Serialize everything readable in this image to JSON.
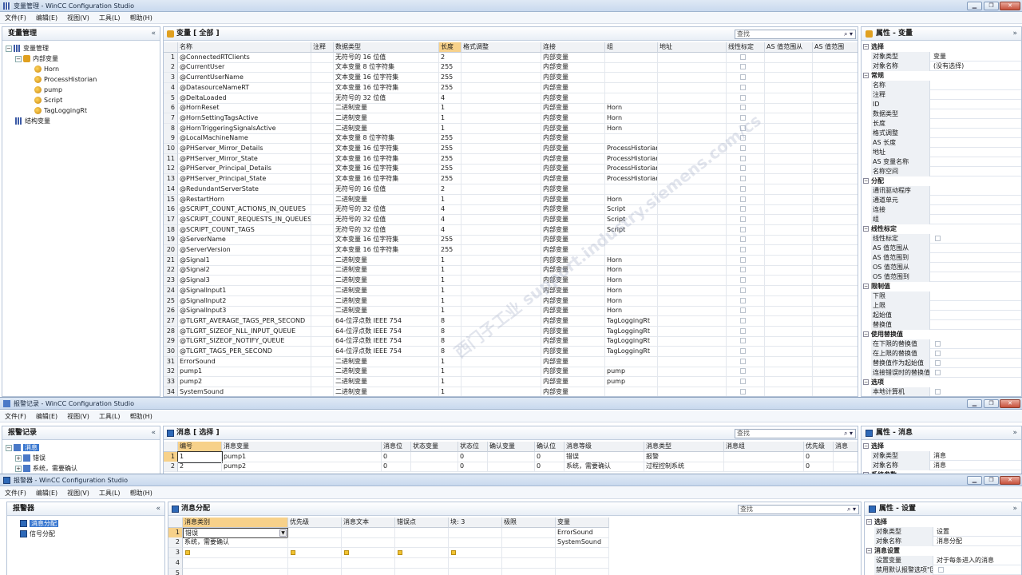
{
  "window1": {
    "title": "变量管理 - WinCC Configuration Studio",
    "menu": [
      "文件(F)",
      "编辑(E)",
      "视图(V)",
      "工具(L)",
      "帮助(H)"
    ],
    "nav_title": "变量管理",
    "tree": [
      {
        "label": "变量管理",
        "level": 0,
        "toggle": "−",
        "icon": "ic-bars",
        "name": "tree-tag-management"
      },
      {
        "label": "内部变量",
        "level": 1,
        "toggle": "−",
        "icon": "ic-db",
        "name": "tree-internal-tags"
      },
      {
        "label": "Horn",
        "level": 2,
        "icon": "ic-tag",
        "name": "tree-group-horn"
      },
      {
        "label": "ProcessHistorian",
        "level": 2,
        "icon": "ic-tag",
        "name": "tree-group-processhistorian"
      },
      {
        "label": "pump",
        "level": 2,
        "icon": "ic-tag",
        "name": "tree-group-pump"
      },
      {
        "label": "Script",
        "level": 2,
        "icon": "ic-tag",
        "name": "tree-group-script"
      },
      {
        "label": "TagLoggingRt",
        "level": 2,
        "icon": "ic-tag",
        "name": "tree-group-tagloggingrt"
      },
      {
        "label": "结构变量",
        "level": 0,
        "icon": "ic-bars",
        "name": "tree-struct-tags"
      }
    ],
    "grid_title": "变量 [ 全部 ]",
    "search_placeholder": "查找",
    "columns": [
      "",
      "名称",
      "注释",
      "数据类型",
      "长度",
      "格式调整",
      "连接",
      "组",
      "地址",
      "线性标定",
      "AS 值范围从",
      "AS 值范围"
    ],
    "rows": [
      [
        "1",
        "@ConnectedRTClients",
        "",
        "无符号的 16 位值",
        "2",
        "",
        "内部变量",
        "",
        ""
      ],
      [
        "2",
        "@CurrentUser",
        "",
        "文本变量 8 位字符集",
        "255",
        "",
        "内部变量",
        "",
        ""
      ],
      [
        "3",
        "@CurrentUserName",
        "",
        "文本变量 16 位字符集",
        "255",
        "",
        "内部变量",
        "",
        ""
      ],
      [
        "4",
        "@DatasourceNameRT",
        "",
        "文本变量 16 位字符集",
        "255",
        "",
        "内部变量",
        "",
        ""
      ],
      [
        "5",
        "@DeltaLoaded",
        "",
        "无符号的 32 位值",
        "4",
        "",
        "内部变量",
        "",
        ""
      ],
      [
        "6",
        "@HornReset",
        "",
        "二进制变量",
        "1",
        "",
        "内部变量",
        "Horn",
        ""
      ],
      [
        "7",
        "@HornSettingTagsActive",
        "",
        "二进制变量",
        "1",
        "",
        "内部变量",
        "Horn",
        ""
      ],
      [
        "8",
        "@HornTriggeringSignalsActive",
        "",
        "二进制变量",
        "1",
        "",
        "内部变量",
        "Horn",
        ""
      ],
      [
        "9",
        "@LocalMachineName",
        "",
        "文本变量 8 位字符集",
        "255",
        "",
        "内部变量",
        "",
        ""
      ],
      [
        "10",
        "@PHServer_Mirror_Details",
        "",
        "文本变量 16 位字符集",
        "255",
        "",
        "内部变量",
        "ProcessHistorian",
        ""
      ],
      [
        "11",
        "@PHServer_Mirror_State",
        "",
        "文本变量 16 位字符集",
        "255",
        "",
        "内部变量",
        "ProcessHistorian",
        ""
      ],
      [
        "12",
        "@PHServer_Principal_Details",
        "",
        "文本变量 16 位字符集",
        "255",
        "",
        "内部变量",
        "ProcessHistorian",
        ""
      ],
      [
        "13",
        "@PHServer_Principal_State",
        "",
        "文本变量 16 位字符集",
        "255",
        "",
        "内部变量",
        "ProcessHistorian",
        ""
      ],
      [
        "14",
        "@RedundantServerState",
        "",
        "无符号的 16 位值",
        "2",
        "",
        "内部变量",
        "",
        ""
      ],
      [
        "15",
        "@RestartHorn",
        "",
        "二进制变量",
        "1",
        "",
        "内部变量",
        "Horn",
        ""
      ],
      [
        "16",
        "@SCRIPT_COUNT_ACTIONS_IN_QUEUES",
        "",
        "无符号的 32 位值",
        "4",
        "",
        "内部变量",
        "Script",
        ""
      ],
      [
        "17",
        "@SCRIPT_COUNT_REQUESTS_IN_QUEUES",
        "",
        "无符号的 32 位值",
        "4",
        "",
        "内部变量",
        "Script",
        ""
      ],
      [
        "18",
        "@SCRIPT_COUNT_TAGS",
        "",
        "无符号的 32 位值",
        "4",
        "",
        "内部变量",
        "Script",
        ""
      ],
      [
        "19",
        "@ServerName",
        "",
        "文本变量 16 位字符集",
        "255",
        "",
        "内部变量",
        "",
        ""
      ],
      [
        "20",
        "@ServerVersion",
        "",
        "文本变量 16 位字符集",
        "255",
        "",
        "内部变量",
        "",
        ""
      ],
      [
        "21",
        "@Signal1",
        "",
        "二进制变量",
        "1",
        "",
        "内部变量",
        "Horn",
        ""
      ],
      [
        "22",
        "@Signal2",
        "",
        "二进制变量",
        "1",
        "",
        "内部变量",
        "Horn",
        ""
      ],
      [
        "23",
        "@Signal3",
        "",
        "二进制变量",
        "1",
        "",
        "内部变量",
        "Horn",
        ""
      ],
      [
        "24",
        "@SignalInput1",
        "",
        "二进制变量",
        "1",
        "",
        "内部变量",
        "Horn",
        ""
      ],
      [
        "25",
        "@SignalInput2",
        "",
        "二进制变量",
        "1",
        "",
        "内部变量",
        "Horn",
        ""
      ],
      [
        "26",
        "@SignalInput3",
        "",
        "二进制变量",
        "1",
        "",
        "内部变量",
        "Horn",
        ""
      ],
      [
        "27",
        "@TLGRT_AVERAGE_TAGS_PER_SECOND",
        "",
        "64-位浮点数 IEEE 754",
        "8",
        "",
        "内部变量",
        "TagLoggingRt",
        ""
      ],
      [
        "28",
        "@TLGRT_SIZEOF_NLL_INPUT_QUEUE",
        "",
        "64-位浮点数 IEEE 754",
        "8",
        "",
        "内部变量",
        "TagLoggingRt",
        ""
      ],
      [
        "29",
        "@TLGRT_SIZEOF_NOTIFY_QUEUE",
        "",
        "64-位浮点数 IEEE 754",
        "8",
        "",
        "内部变量",
        "TagLoggingRt",
        ""
      ],
      [
        "30",
        "@TLGRT_TAGS_PER_SECOND",
        "",
        "64-位浮点数 IEEE 754",
        "8",
        "",
        "内部变量",
        "TagLoggingRt",
        ""
      ],
      [
        "31",
        "ErrorSound",
        "",
        "二进制变量",
        "1",
        "",
        "内部变量",
        "",
        ""
      ],
      [
        "32",
        "pump1",
        "",
        "二进制变量",
        "1",
        "",
        "内部变量",
        "pump",
        ""
      ],
      [
        "33",
        "pump2",
        "",
        "二进制变量",
        "1",
        "",
        "内部变量",
        "pump",
        ""
      ],
      [
        "34",
        "SystemSound",
        "",
        "二进制变量",
        "1",
        "",
        "内部变量",
        "",
        ""
      ]
    ],
    "prop_title": "属性 - 变量",
    "props": [
      {
        "g": "选择",
        "items": [
          [
            "对象类型",
            "变量"
          ],
          [
            "对象名称",
            "(没有选择)"
          ]
        ]
      },
      {
        "g": "常规",
        "items": [
          [
            "名称",
            ""
          ],
          [
            "注释",
            ""
          ],
          [
            "ID",
            ""
          ],
          [
            "数据类型",
            ""
          ],
          [
            "长度",
            ""
          ],
          [
            "格式调整",
            ""
          ],
          [
            "AS 长度",
            ""
          ],
          [
            "地址",
            ""
          ],
          [
            "AS 变量名称",
            ""
          ],
          [
            "名称空间",
            ""
          ]
        ]
      },
      {
        "g": "分配",
        "items": [
          [
            "通讯驱动程序",
            ""
          ],
          [
            "通道单元",
            ""
          ],
          [
            "连接",
            ""
          ],
          [
            "组",
            ""
          ]
        ]
      },
      {
        "g": "线性标定",
        "items": [
          [
            "线性标定",
            "cb"
          ],
          [
            "AS 值范围从",
            ""
          ],
          [
            "AS 值范围到",
            ""
          ],
          [
            "OS 值范围从",
            ""
          ],
          [
            "OS 值范围到",
            ""
          ]
        ]
      },
      {
        "g": "限制值",
        "items": [
          [
            "下限",
            ""
          ],
          [
            "上限",
            ""
          ],
          [
            "起始值",
            ""
          ],
          [
            "替换值",
            ""
          ]
        ]
      },
      {
        "g": "使用替换值",
        "items": [
          [
            "在下限的替换值",
            "cb"
          ],
          [
            "在上限的替换值",
            "cb"
          ],
          [
            "替换值作为起始值",
            "cb"
          ],
          [
            "连接错误时的替换值",
            "cb"
          ]
        ]
      },
      {
        "g": "选项",
        "items": [
          [
            "本地计算机",
            "cb"
          ]
        ]
      }
    ]
  },
  "watermark": "西门子工业 support.industry.siemens.com/cs",
  "window2": {
    "title": "报警记录 - WinCC Configuration Studio",
    "menu": [
      "文件(F)",
      "编辑(E)",
      "视图(V)",
      "工具(L)",
      "帮助(H)"
    ],
    "nav_title": "报警记录",
    "tree": [
      {
        "label": "消息",
        "level": 0,
        "toggle": "−",
        "icon": "ic-alarm",
        "name": "tree-messages",
        "selected": true
      },
      {
        "label": "错误",
        "level": 1,
        "toggle": "+",
        "icon": "ic-alarm",
        "name": "tree-error"
      },
      {
        "label": "系统，需要确认",
        "level": 1,
        "toggle": "+",
        "icon": "ic-alarm",
        "name": "tree-system-ack"
      }
    ],
    "grid_title": "消息 [ 选择 ]",
    "search_placeholder": "查找",
    "columns": [
      "",
      "编号",
      "消息变量",
      "消息位",
      "状态变量",
      "状态位",
      "确认变量",
      "确认位",
      "消息等级",
      "消息类型",
      "消息组",
      "优先级",
      "消息"
    ],
    "rows": [
      [
        "1",
        "1",
        "pump1",
        "0",
        "",
        "0",
        "",
        "0",
        "错误",
        "报警",
        "",
        "0"
      ],
      [
        "2",
        "2",
        "pump2",
        "0",
        "",
        "0",
        "",
        "0",
        "系统，需要确认",
        "过程控制系统",
        "",
        "0"
      ]
    ],
    "prop_title": "属性 - 消息",
    "props": [
      {
        "g": "选择",
        "items": [
          [
            "对象类型",
            "消息"
          ],
          [
            "对象名称",
            "消息"
          ]
        ]
      }
    ],
    "props_more": "系统参数"
  },
  "window3": {
    "title": "报警器 - WinCC Configuration Studio",
    "menu": [
      "文件(F)",
      "编辑(E)",
      "视图(V)",
      "工具(L)",
      "帮助(H)"
    ],
    "nav_title": "报警器",
    "tree": [
      {
        "label": "消息分配",
        "level": 0,
        "icon": "ic-msg",
        "name": "tree-message-assignment",
        "selected": true
      },
      {
        "label": "信号分配",
        "level": 0,
        "icon": "ic-msg",
        "name": "tree-signal-assignment"
      }
    ],
    "grid_title": "消息分配",
    "search_placeholder": "查找",
    "columns": [
      "",
      "消息类别",
      "优先级",
      "消息文本",
      "错误点",
      "块: 3",
      "极限",
      "变量"
    ],
    "rows": [
      [
        "1",
        "错误",
        "",
        "",
        "",
        "",
        "",
        "ErrorSound"
      ],
      [
        "2",
        "系统，需要确认",
        "",
        "",
        "",
        "",
        "",
        "SystemSound"
      ],
      [
        "3",
        "",
        "",
        "",
        "",
        "",
        "",
        ""
      ],
      [
        "4",
        "",
        "",
        "",
        "",
        "",
        "",
        ""
      ],
      [
        "5",
        "",
        "",
        "",
        "",
        "",
        "",
        ""
      ]
    ],
    "prop_title": "属性 - 设置",
    "props": [
      {
        "g": "选择",
        "items": [
          [
            "对象类型",
            "设置"
          ],
          [
            "对象名称",
            "消息分配"
          ]
        ]
      },
      {
        "g": "消息设置",
        "items": [
          [
            "设置变量",
            "对于每条进入的消息"
          ],
          [
            "禁用默认报警选项\"区域权限\"",
            "cb"
          ]
        ]
      }
    ]
  }
}
